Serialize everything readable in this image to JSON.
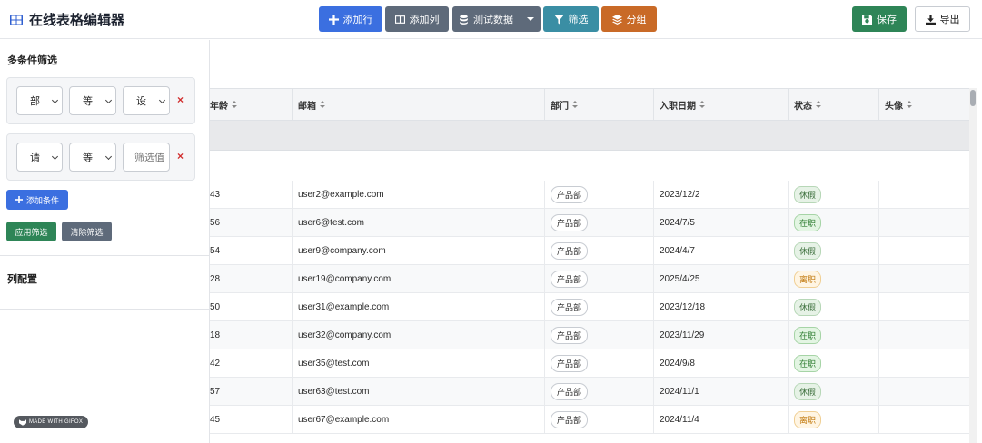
{
  "header": {
    "title": "在线表格编辑器",
    "buttons": {
      "add_row": "添加行",
      "add_col": "添加列",
      "test_data": "测试数据",
      "filter": "筛选",
      "group": "分组",
      "save": "保存",
      "export": "导出"
    }
  },
  "filter_panel": {
    "title": "多条件筛选",
    "conditions": [
      {
        "field": "部",
        "operator": "等",
        "value": "设",
        "value_type": "select"
      },
      {
        "field": "请",
        "operator": "等",
        "value": "",
        "placeholder": "筛选值",
        "value_type": "input"
      }
    ],
    "add_condition": "添加条件",
    "apply": "应用筛选",
    "clear": "清除筛选",
    "delete_symbol": "×"
  },
  "column_config": {
    "title": "列配置"
  },
  "badge": {
    "text": "MADE WITH GIFOX"
  },
  "table": {
    "columns": [
      "年龄",
      "邮箱",
      "部门",
      "入职日期",
      "状态",
      "头像"
    ],
    "rows": [
      {
        "age": "43",
        "email": "user2@example.com",
        "dept": "产品部",
        "date": "2023/12/2",
        "status": "休假",
        "status_type": "leave"
      },
      {
        "age": "56",
        "email": "user6@test.com",
        "dept": "产品部",
        "date": "2024/7/5",
        "status": "在职",
        "status_type": "on"
      },
      {
        "age": "54",
        "email": "user9@company.com",
        "dept": "产品部",
        "date": "2024/4/7",
        "status": "休假",
        "status_type": "leave"
      },
      {
        "age": "28",
        "email": "user19@company.com",
        "dept": "产品部",
        "date": "2025/4/25",
        "status": "离职",
        "status_type": "off"
      },
      {
        "age": "50",
        "email": "user31@example.com",
        "dept": "产品部",
        "date": "2023/12/18",
        "status": "休假",
        "status_type": "leave"
      },
      {
        "age": "18",
        "email": "user32@company.com",
        "dept": "产品部",
        "date": "2023/11/29",
        "status": "在职",
        "status_type": "on"
      },
      {
        "age": "42",
        "email": "user35@test.com",
        "dept": "产品部",
        "date": "2024/9/8",
        "status": "在职",
        "status_type": "on"
      },
      {
        "age": "57",
        "email": "user63@test.com",
        "dept": "产品部",
        "date": "2024/11/1",
        "status": "休假",
        "status_type": "leave"
      },
      {
        "age": "45",
        "email": "user67@example.com",
        "dept": "产品部",
        "date": "2024/11/4",
        "status": "离职",
        "status_type": "off"
      }
    ]
  },
  "colors": {
    "primary": "#3b6fe0",
    "gray": "#5e6a7a",
    "teal": "#3a8ea4",
    "orange": "#c96a27",
    "green": "#2e8557",
    "danger": "#d12d2d"
  }
}
